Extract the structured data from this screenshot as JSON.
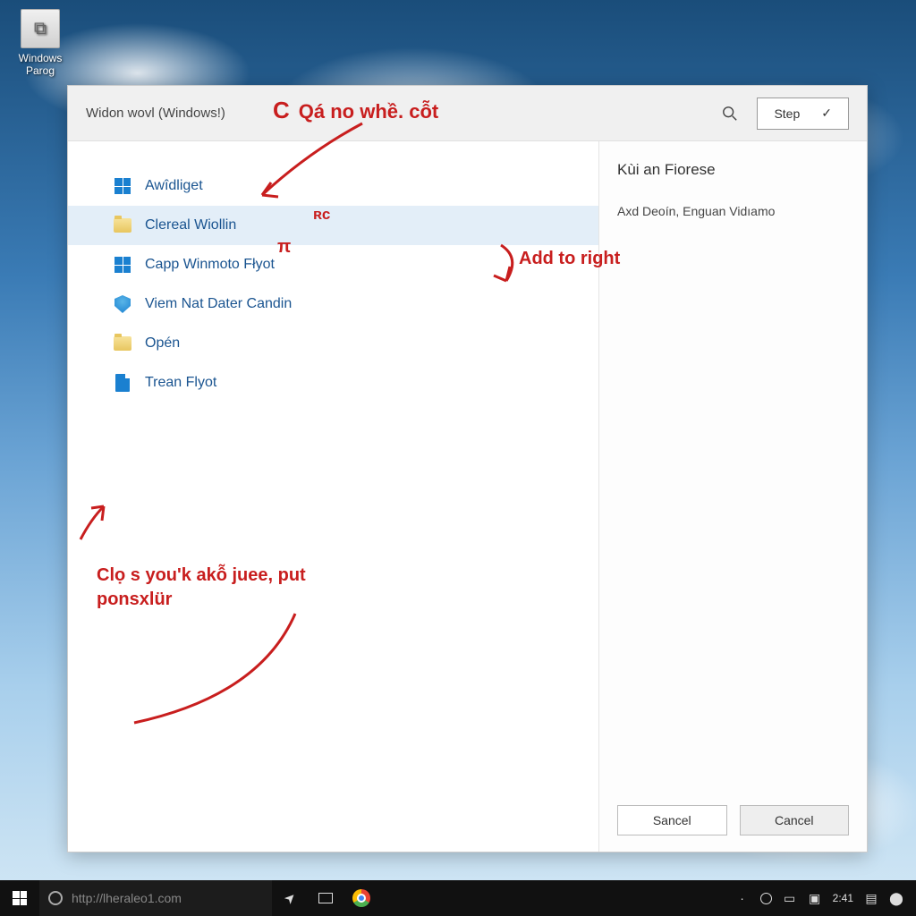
{
  "desktop_icon": {
    "label": "Windows\nParog"
  },
  "window": {
    "title": "Widon wovl (Windows!)",
    "search_placeholder": "Search",
    "step_button": "Step"
  },
  "menu": {
    "items": [
      {
        "label": "Awîdliget",
        "icon": "tiles"
      },
      {
        "label": "Clereal Wiollin",
        "icon": "folder",
        "selected": true
      },
      {
        "label": "Capp Winmoto Fłyot",
        "icon": "tiles"
      },
      {
        "label": "Viem Nat Dater Candin",
        "icon": "shield"
      },
      {
        "label": "Opén",
        "icon": "folder"
      },
      {
        "label": "Trean Flyot",
        "icon": "doc"
      }
    ]
  },
  "right_pane": {
    "title": "Kùi an Fiorese",
    "subtitle": "Axd Deoín, Enguan Vidıamo",
    "primary_button": "Sancel",
    "secondary_button": "Cancel"
  },
  "annotations": {
    "top": "Qá no whề. cỗt",
    "top_sm1": "ʀc",
    "top_sm2": "π",
    "right": "Add to right",
    "bottom": "Clọ s you'k akỗ juee, put ponsxlür"
  },
  "taskbar": {
    "search_placeholder": "http://lheraleo1.com",
    "clock": "2:41"
  }
}
